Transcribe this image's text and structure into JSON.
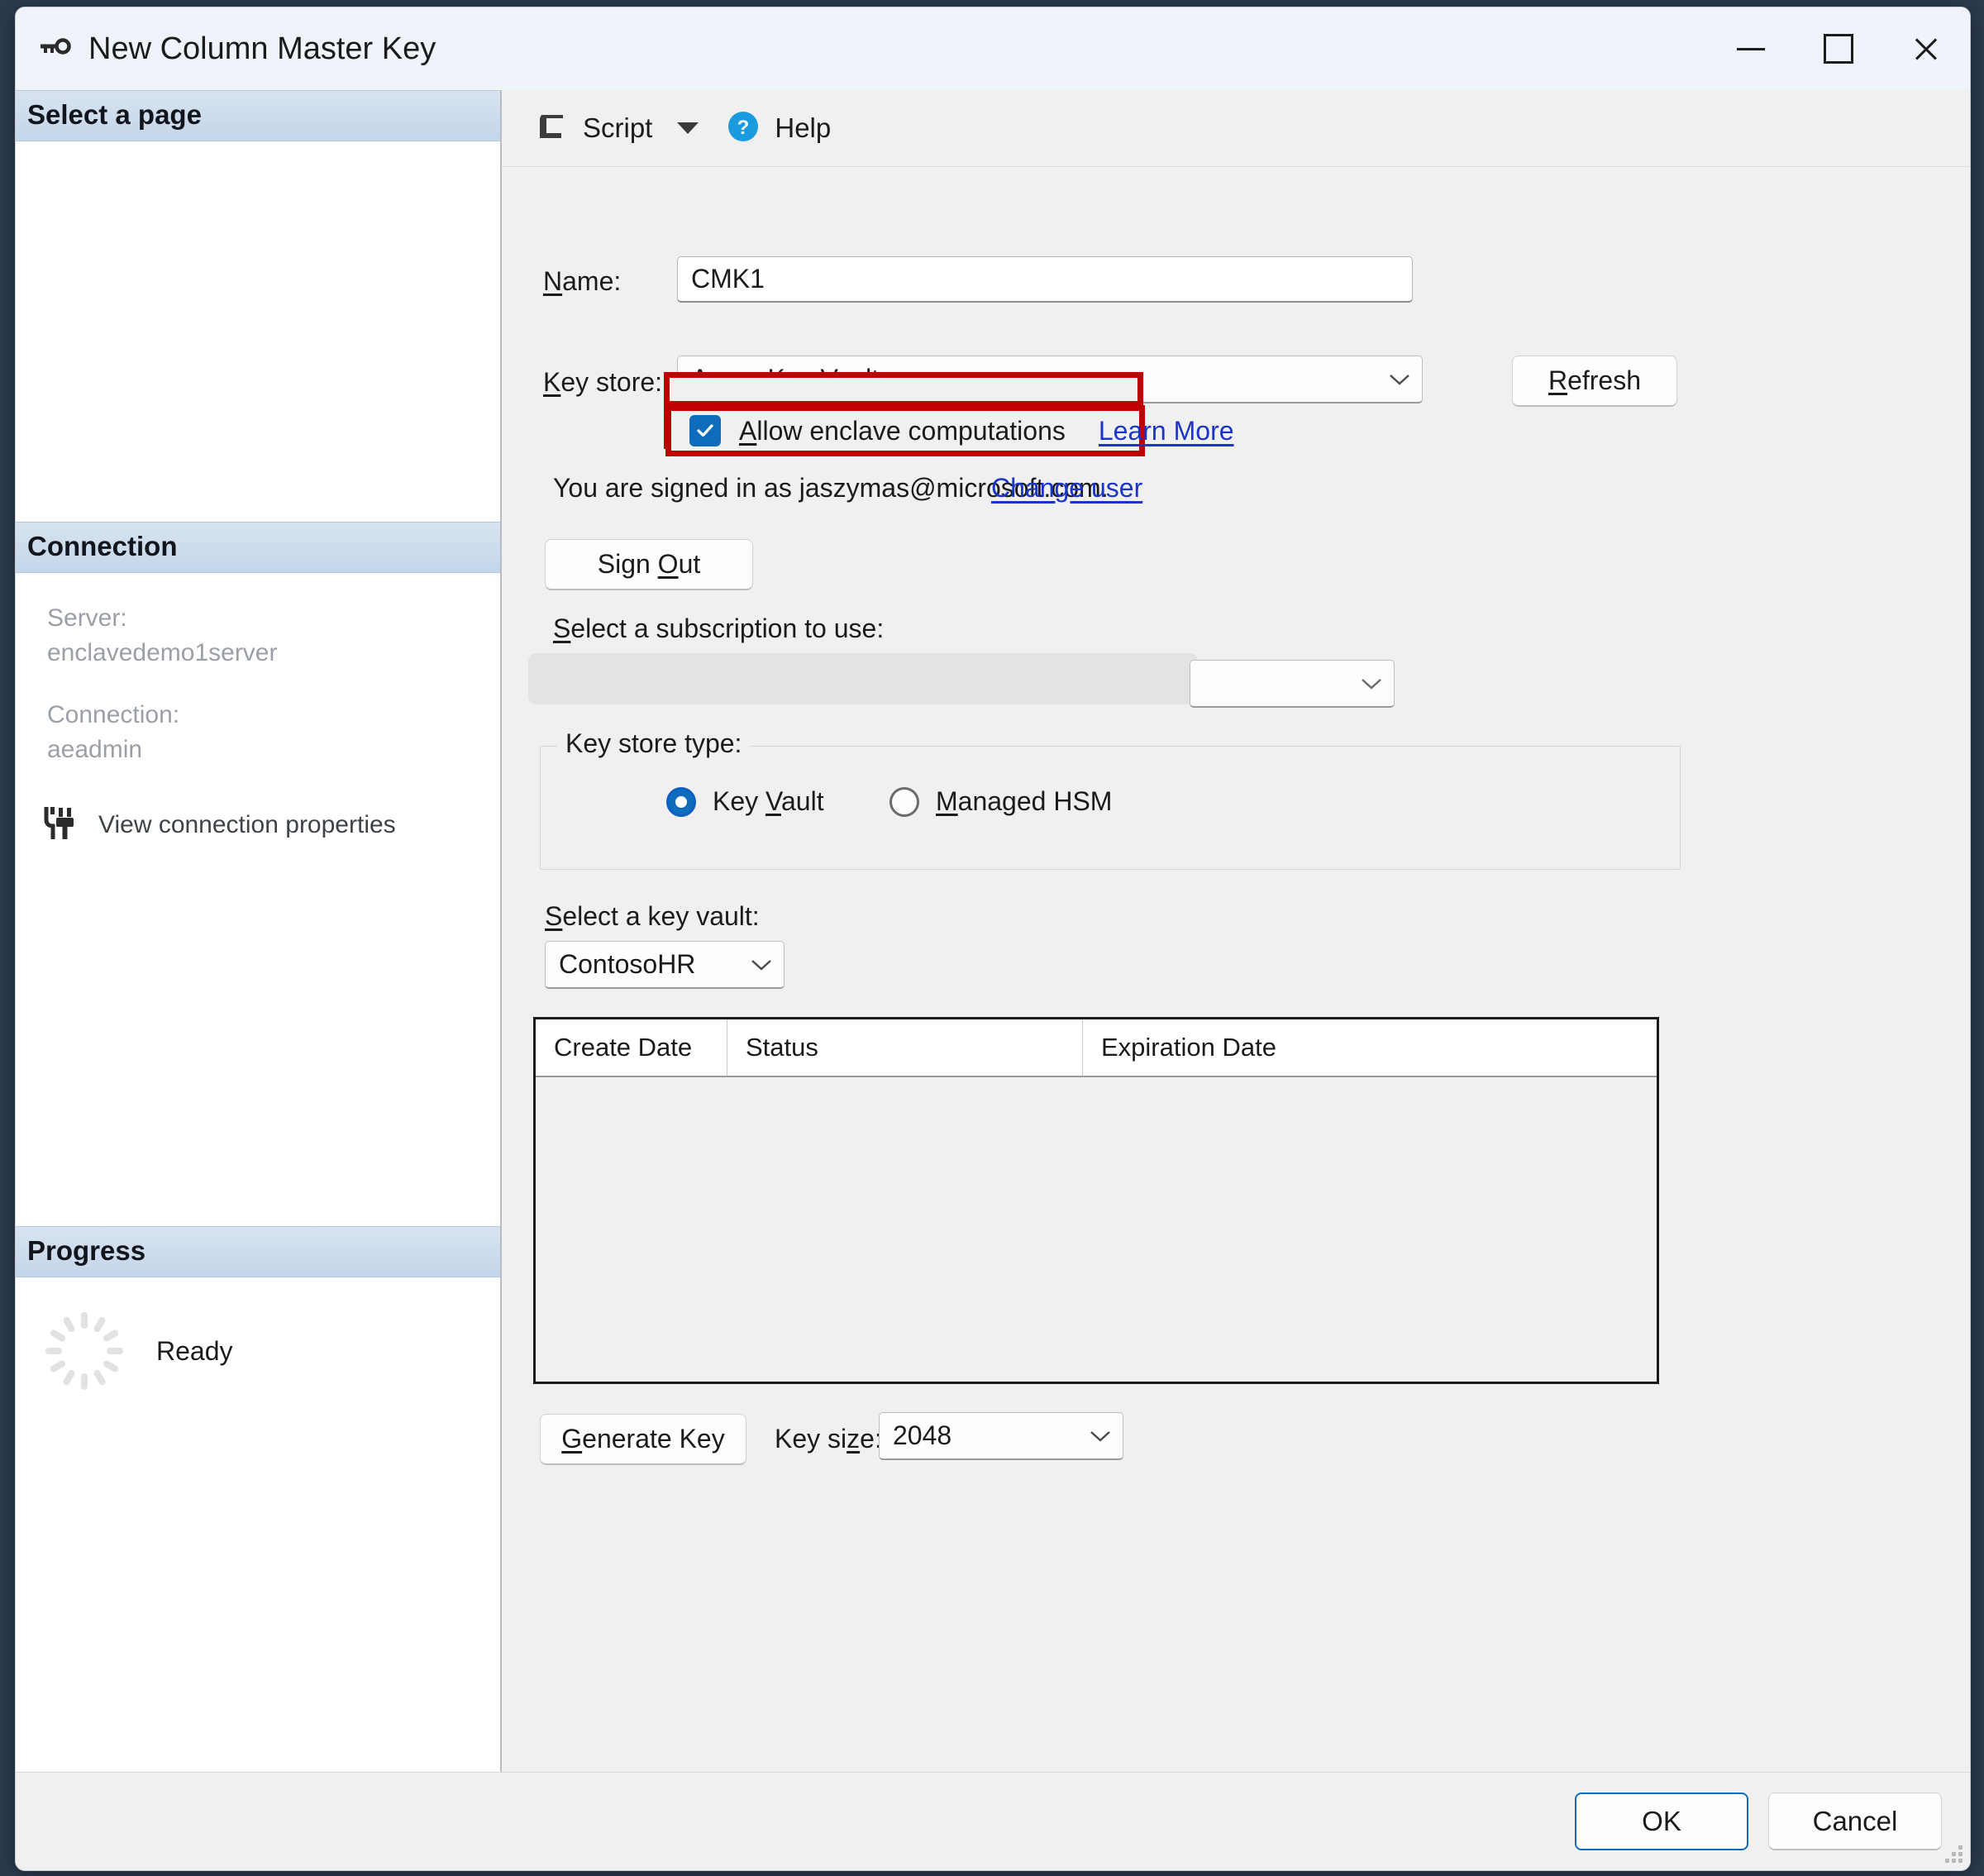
{
  "window": {
    "title": "New Column Master Key",
    "icon": "key-icon",
    "controls": {
      "minimize": "Minimize",
      "maximize": "Maximize",
      "close": "Close"
    }
  },
  "toolbar": {
    "script_label": "Script",
    "script_icon": "script-icon",
    "dropdown_icon": "chevron-down-icon",
    "help_label": "Help",
    "help_icon": "help-circle-icon"
  },
  "sidebar": {
    "select_page_header": "Select a page",
    "connection_header": "Connection",
    "connection": {
      "server_label": "Server:",
      "server_value": "enclavedemo1server",
      "connection_label": "Connection:",
      "connection_value": "aeadmin",
      "view_properties": "View connection properties",
      "view_properties_icon": "connection-plug-icon"
    },
    "progress_header": "Progress",
    "progress": {
      "status": "Ready",
      "spinner_icon": "spinner-icon"
    }
  },
  "form": {
    "name_label": "Name:",
    "name_value": "CMK1",
    "key_store_label": "Key store:",
    "key_store_value": "Azure Key Vault",
    "refresh_label": "Refresh",
    "allow_enclave_label": "Allow enclave computations",
    "allow_enclave_checked": true,
    "learn_more_label": "Learn More",
    "signed_in_text": "You are signed in as jaszymas@microsoft.com.",
    "change_user_label": "Change user",
    "sign_out_label": "Sign Out",
    "subscription_label": "Select a subscription to use:",
    "subscription_value": "",
    "key_store_type_label": "Key store type:",
    "key_vault_radio_label": "Key Vault",
    "managed_hsm_radio_label": "Managed HSM",
    "key_store_type_selected": "Key Vault",
    "select_key_vault_label": "Select a key vault:",
    "selected_key_vault": "ContosoHR",
    "generate_key_label": "Generate Key",
    "key_size_label": "Key size:",
    "key_size_value": "2048"
  },
  "table": {
    "columns": [
      "Create Date",
      "Status",
      "Expiration Date"
    ],
    "rows": []
  },
  "footer": {
    "ok_label": "OK",
    "cancel_label": "Cancel"
  },
  "colors": {
    "accent": "#0f6cbd",
    "link": "#1a35c8",
    "highlight": "#c00000",
    "section_header": "#c4d6ea"
  }
}
